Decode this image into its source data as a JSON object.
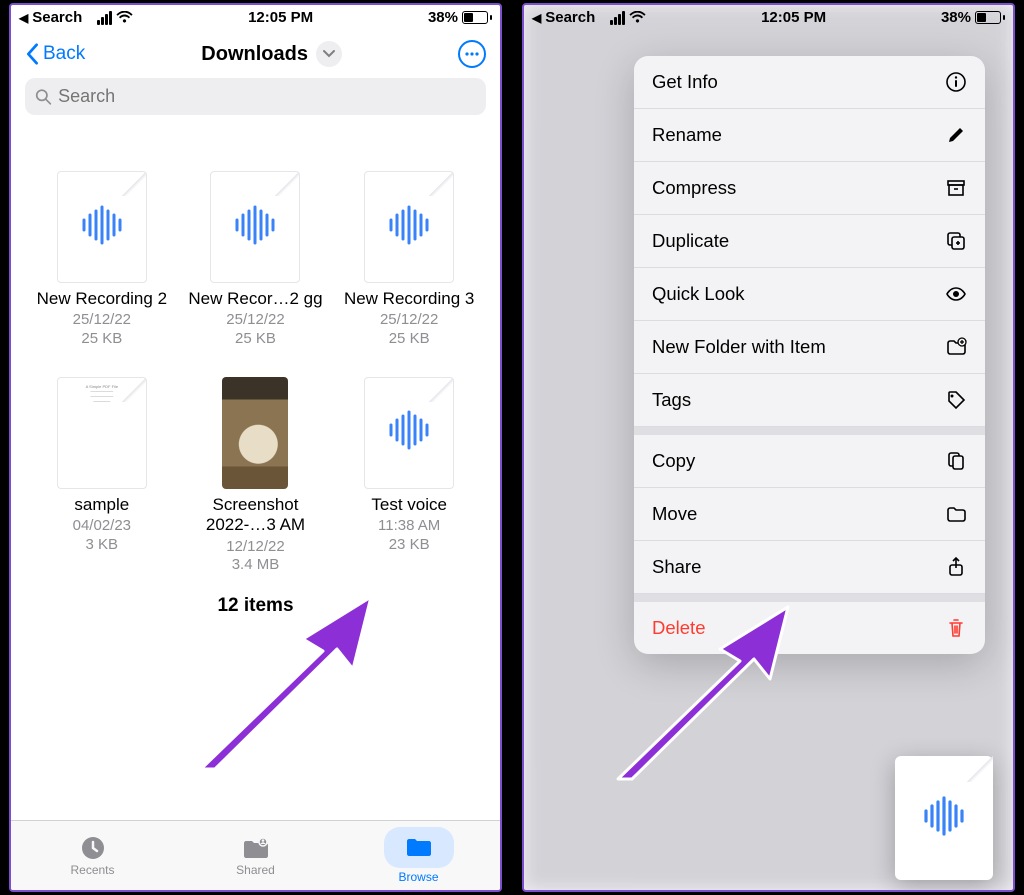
{
  "statusbar": {
    "back_app": "Search",
    "time": "12:05 PM",
    "battery_pct": "38%"
  },
  "nav": {
    "back_label": "Back",
    "title": "Downloads"
  },
  "search": {
    "placeholder": "Search"
  },
  "files": [
    {
      "name": "New Recording 2",
      "date": "25/12/22",
      "size": "25 KB",
      "kind": "audio"
    },
    {
      "name": "New Recor…2 gg",
      "date": "25/12/22",
      "size": "25 KB",
      "kind": "audio"
    },
    {
      "name": "New Recording 3",
      "date": "25/12/22",
      "size": "25 KB",
      "kind": "audio"
    },
    {
      "name": "sample",
      "date": "04/02/23",
      "size": "3 KB",
      "kind": "doc"
    },
    {
      "name": "Screenshot 2022-…3 AM",
      "date": "12/12/22",
      "size": "3.4 MB",
      "kind": "photo"
    },
    {
      "name": "Test voice",
      "date": "11:38 AM",
      "size": "23 KB",
      "kind": "audio"
    }
  ],
  "item_count": "12 items",
  "tabs": {
    "recents": "Recents",
    "shared": "Shared",
    "browse": "Browse"
  },
  "context_menu": {
    "get_info": "Get Info",
    "rename": "Rename",
    "compress": "Compress",
    "duplicate": "Duplicate",
    "quick_look": "Quick Look",
    "new_folder": "New Folder with Item",
    "tags": "Tags",
    "copy": "Copy",
    "move": "Move",
    "share": "Share",
    "delete": "Delete"
  },
  "colors": {
    "accent": "#007aff",
    "destructive": "#ff3b30",
    "annotation": "#8c2fd6"
  }
}
